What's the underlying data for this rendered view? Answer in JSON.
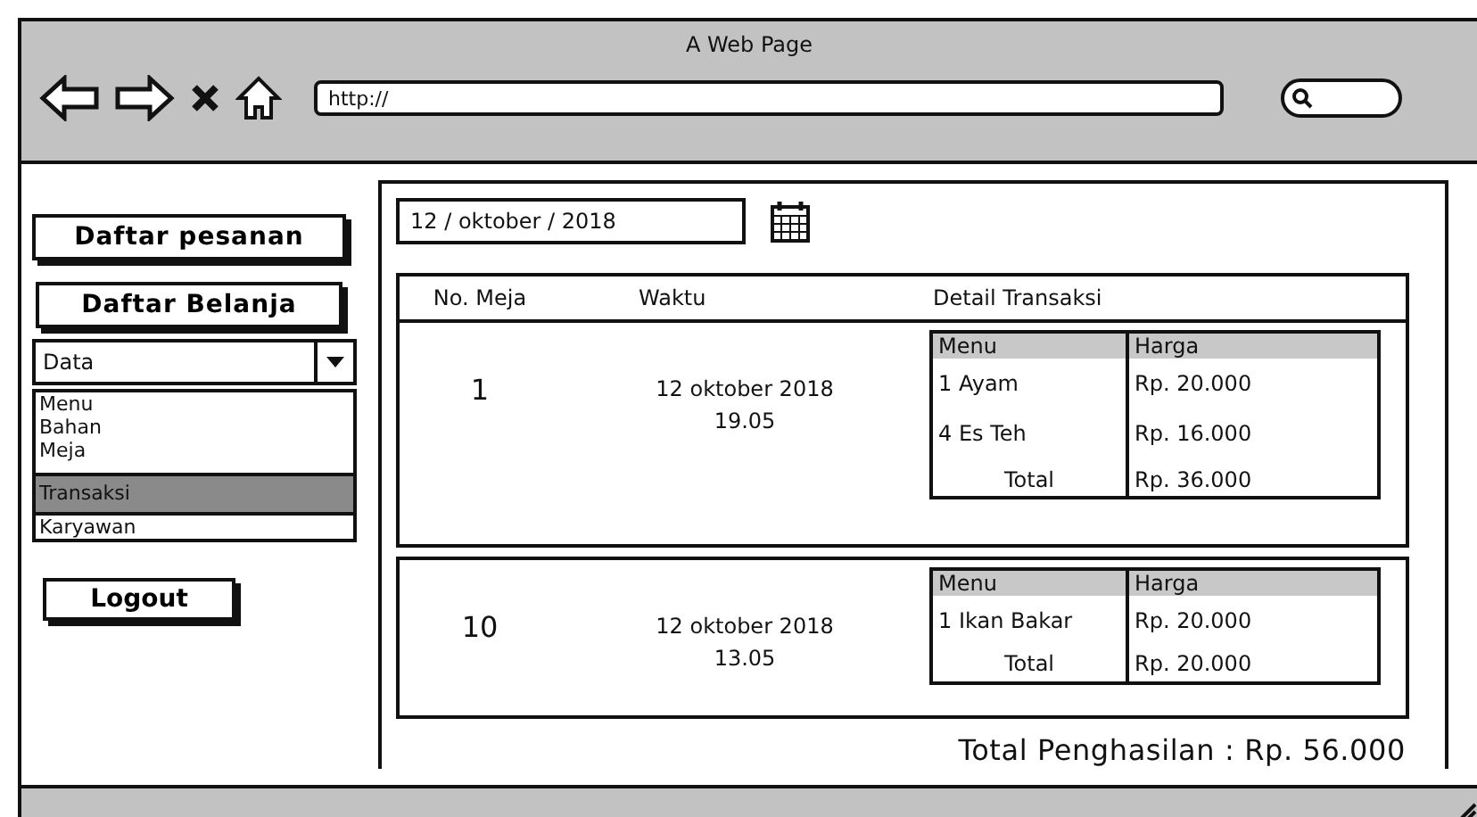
{
  "window": {
    "title": "A Web Page",
    "url": "http://"
  },
  "sidebar": {
    "buttons": [
      {
        "label": "Daftar pesanan"
      },
      {
        "label": "Daftar Belanja"
      }
    ],
    "dropdown": {
      "value": "Data",
      "items": [
        {
          "label": "Menu",
          "selected": false
        },
        {
          "label": "Bahan",
          "selected": false
        },
        {
          "label": "Meja",
          "selected": false
        },
        {
          "label": "Transaksi",
          "selected": true
        },
        {
          "label": "Karyawan",
          "selected": false
        }
      ]
    },
    "logout": "Logout"
  },
  "date_field": {
    "value": "12  / oktober / 2018"
  },
  "table": {
    "columns": [
      "No. Meja",
      "Waktu",
      "Detail Transaksi"
    ],
    "rows": [
      {
        "no_meja": "1",
        "date": "12 oktober 2018",
        "time": "19.05",
        "detail": {
          "columns": [
            "Menu",
            "Harga"
          ],
          "items": [
            {
              "menu": "1 Ayam",
              "harga": "Rp. 20.000"
            },
            {
              "menu": "4 Es Teh",
              "harga": "Rp. 16.000"
            }
          ],
          "total_label": "Total",
          "total": "Rp. 36.000"
        }
      },
      {
        "no_meja": "10",
        "date": "12 oktober 2018",
        "time": "13.05",
        "detail": {
          "columns": [
            "Menu",
            "Harga"
          ],
          "items": [
            {
              "menu": "1 Ikan Bakar",
              "harga": "Rp. 20.000"
            }
          ],
          "total_label": "Total",
          "total": "Rp. 20.000"
        }
      }
    ]
  },
  "total_income": "Total Penghasilan : Rp. 56.000"
}
